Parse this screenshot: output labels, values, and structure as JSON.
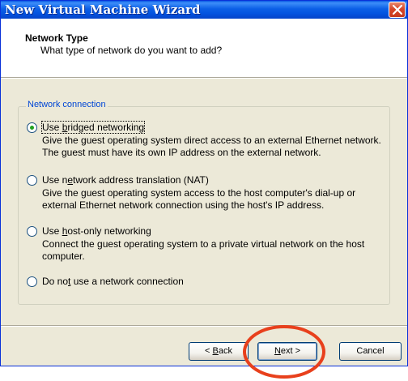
{
  "window": {
    "title": "New Virtual Machine Wizard"
  },
  "header": {
    "title": "Network Type",
    "subtitle": "What type of network do you want to add?"
  },
  "group": {
    "legend": "Network connection"
  },
  "options": [
    {
      "label_pre": "Use ",
      "label_ul": "b",
      "label_post": "ridged networking",
      "selected": true,
      "desc_line1": "Give the guest operating system direct access to an external Ethernet network.",
      "desc_line2": "The guest must have its own IP address on the external network."
    },
    {
      "label_pre": "Use n",
      "label_ul": "e",
      "label_post": "twork address translation (NAT)",
      "selected": false,
      "desc_line1": "Give the guest operating system access to the host computer's dial-up or",
      "desc_line2": "external Ethernet network connection using the host's IP address."
    },
    {
      "label_pre": "Use ",
      "label_ul": "h",
      "label_post": "ost-only networking",
      "selected": false,
      "desc_line1": "Connect the guest operating system to a private virtual network on the host",
      "desc_line2": "computer."
    },
    {
      "label_pre": "Do no",
      "label_ul": "t",
      "label_post": " use a network connection",
      "selected": false
    }
  ],
  "buttons": {
    "back": {
      "pre": "< ",
      "ul": "B",
      "post": "ack"
    },
    "next": {
      "pre": "",
      "ul": "N",
      "post": "ext >"
    },
    "cancel": "Cancel"
  },
  "colors": {
    "title_bar": "#0454e0",
    "dialog_bg": "#ece9d8",
    "legend_text": "#0046d5",
    "highlight_ring": "#e8401c",
    "radio_dot": "#21a121"
  },
  "icons": {
    "close": "close-icon"
  }
}
